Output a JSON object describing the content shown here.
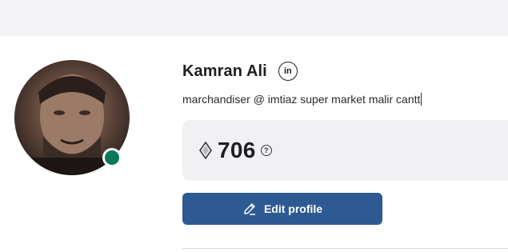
{
  "profile": {
    "name": "Kamran Ali",
    "linkedin_label": "in",
    "headline": "marchandiser @ imtiaz super market malir cantt",
    "status": "online",
    "status_color": "#0a7a58"
  },
  "points": {
    "value": "706",
    "help_label": "?",
    "icon": "gem-icon"
  },
  "actions": {
    "edit_label": "Edit profile",
    "edit_icon": "pencil-icon",
    "accent": "#2d5a93"
  }
}
